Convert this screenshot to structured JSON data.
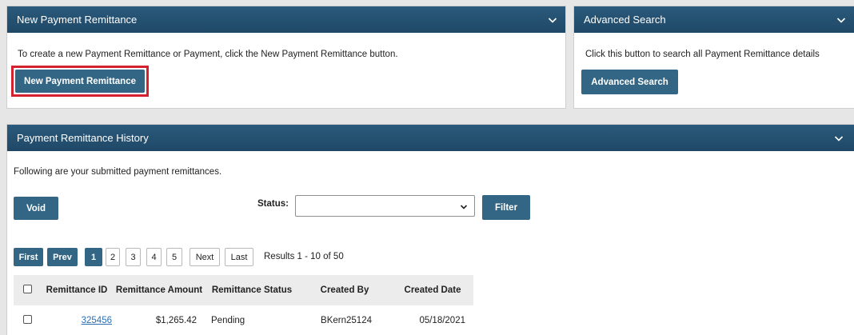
{
  "new_remittance_panel": {
    "title": "New Payment Remittance",
    "description": "To create a new Payment Remittance or Payment, click the New Payment Remittance button.",
    "button_label": "New Payment Remittance"
  },
  "advanced_search_panel": {
    "title": "Advanced Search",
    "description": "Click this button to search all Payment Remittance details",
    "button_label": "Advanced Search"
  },
  "history_panel": {
    "title": "Payment Remittance History",
    "description": "Following are your submitted payment remittances.",
    "void_label": "Void",
    "status_label": "Status:",
    "status_value": "",
    "filter_label": "Filter"
  },
  "pagination": {
    "first": "First",
    "prev": "Prev",
    "pages": [
      "1",
      "2",
      "3",
      "4",
      "5"
    ],
    "current_page": "1",
    "next": "Next",
    "last": "Last",
    "results": "Results 1 - 10 of 50"
  },
  "table": {
    "columns": [
      "Remittance ID",
      "Remittance Amount",
      "Remittance Status",
      "Created By",
      "Created Date"
    ],
    "rows": [
      {
        "id": "325456",
        "amount": "$1,265.42",
        "status": "Pending",
        "created_by": "BKern25124",
        "created_date": "05/18/2021"
      }
    ]
  },
  "colors": {
    "header": "#1f4866",
    "button": "#336684",
    "highlight": "#d32130"
  },
  "icons": {
    "collapse": "chevron-down-icon",
    "dropdown": "chevron-down-icon"
  }
}
